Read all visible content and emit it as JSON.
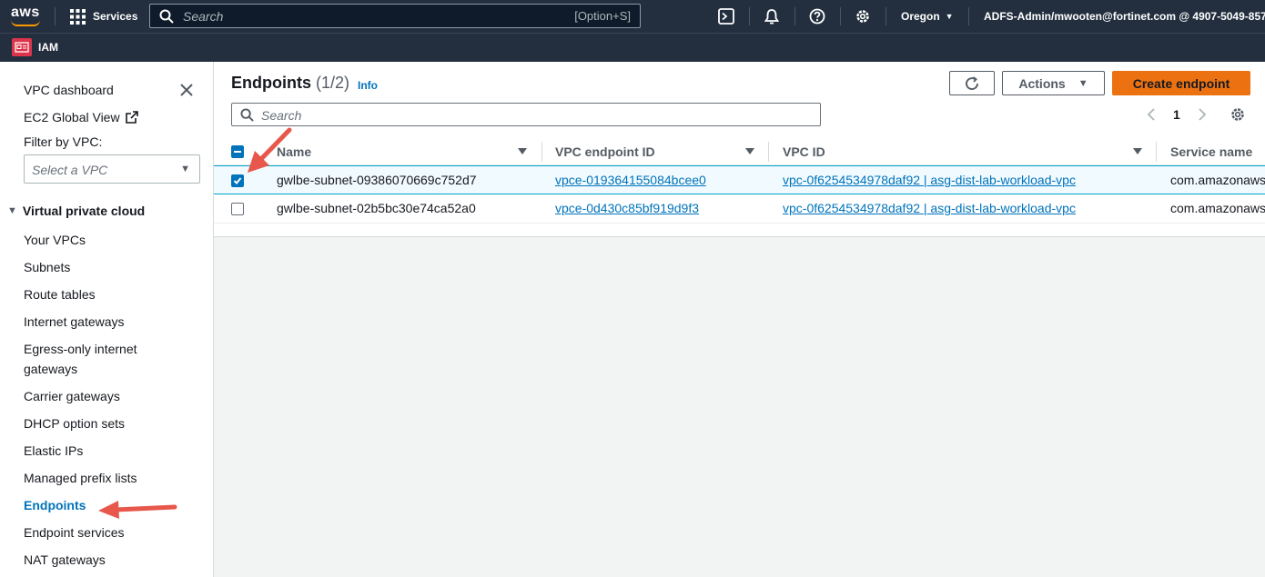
{
  "topbar": {
    "logo": "aws",
    "services": "Services",
    "search_placeholder": "Search",
    "search_shortcut": "[Option+S]",
    "region": "Oregon",
    "account": "ADFS-Admin/mwooten@fortinet.com @ 4907-5049-857"
  },
  "favorites": {
    "iam": "IAM"
  },
  "sidebar": {
    "dashboard": "VPC dashboard",
    "ec2_global": "EC2 Global View",
    "filter_label": "Filter by VPC:",
    "filter_placeholder": "Select a VPC",
    "section": "Virtual private cloud",
    "items": [
      {
        "label": "Your VPCs"
      },
      {
        "label": "Subnets"
      },
      {
        "label": "Route tables"
      },
      {
        "label": "Internet gateways"
      },
      {
        "label": "Egress-only internet gateways"
      },
      {
        "label": "Carrier gateways"
      },
      {
        "label": "DHCP option sets"
      },
      {
        "label": "Elastic IPs"
      },
      {
        "label": "Managed prefix lists"
      },
      {
        "label": "Endpoints",
        "active": true
      },
      {
        "label": "Endpoint services"
      },
      {
        "label": "NAT gateways"
      }
    ]
  },
  "main": {
    "title": "Endpoints",
    "count": "(1/2)",
    "info": "Info",
    "actions_label": "Actions",
    "create_label": "Create endpoint",
    "search_placeholder": "Search",
    "page_number": "1",
    "columns": [
      "Name",
      "VPC endpoint ID",
      "VPC ID",
      "Service name"
    ],
    "rows": [
      {
        "selected": true,
        "name": "gwlbe-subnet-09386070669c752d7",
        "endpoint_id": "vpce-019364155084bcee0",
        "vpc_id": "vpc-0f6254534978daf92 | asg-dist-lab-workload-vpc",
        "service": "com.amazonaws"
      },
      {
        "selected": false,
        "name": "gwlbe-subnet-02b5bc30e74ca52a0",
        "endpoint_id": "vpce-0d430c85bf919d9f3",
        "vpc_id": "vpc-0f6254534978daf92 | asg-dist-lab-workload-vpc",
        "service": "com.amazonaws"
      }
    ]
  },
  "colors": {
    "accent": "#0073bb",
    "orange": "#ec7211",
    "topbar": "#232f3e",
    "annotation_arrow": "#e8574b"
  }
}
